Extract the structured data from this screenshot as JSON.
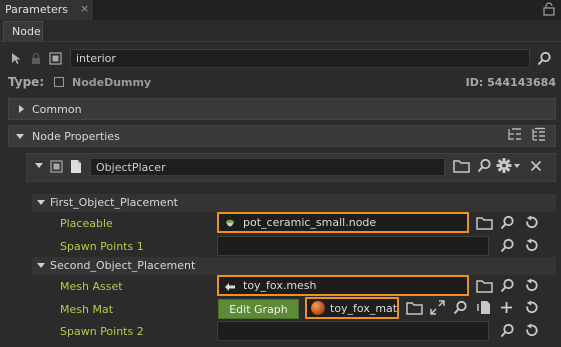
{
  "panel": {
    "title": "Parameters",
    "close_glyph": "×",
    "undock_icon": "lock-icon"
  },
  "tabs": {
    "node": "Node"
  },
  "toolbar": {
    "search_value": "interior",
    "icons": [
      "select-arrow-icon",
      "lock-icon",
      "stop-icon",
      "search-icon"
    ]
  },
  "node_info": {
    "type_label": "Type:",
    "type_value": "NodeDummy",
    "id_text": "ID: 544143684"
  },
  "sections": {
    "common": "Common",
    "node_properties": "Node Properties"
  },
  "placer": {
    "name": "ObjectPlacer"
  },
  "groups": {
    "first": {
      "title": "First_Object_Placement",
      "placeable_label": "Placeable",
      "placeable_value": "pot_ceramic_small.node",
      "spawn_label": "Spawn Points 1",
      "spawn_value": ""
    },
    "second": {
      "title": "Second_Object_Placement",
      "mesh_asset_label": "Mesh Asset",
      "mesh_asset_value": "toy_fox.mesh",
      "mesh_mat_label": "Mesh Mat",
      "edit_graph_label": "Edit Graph",
      "mesh_mat_value": "toy_fox_mat",
      "spawn_label": "Spawn Points 2",
      "spawn_value": ""
    }
  },
  "colors": {
    "accent_orange": "#f0901e",
    "edit_graph_green": "#5d8a34",
    "property_label": "#b9c94a"
  }
}
